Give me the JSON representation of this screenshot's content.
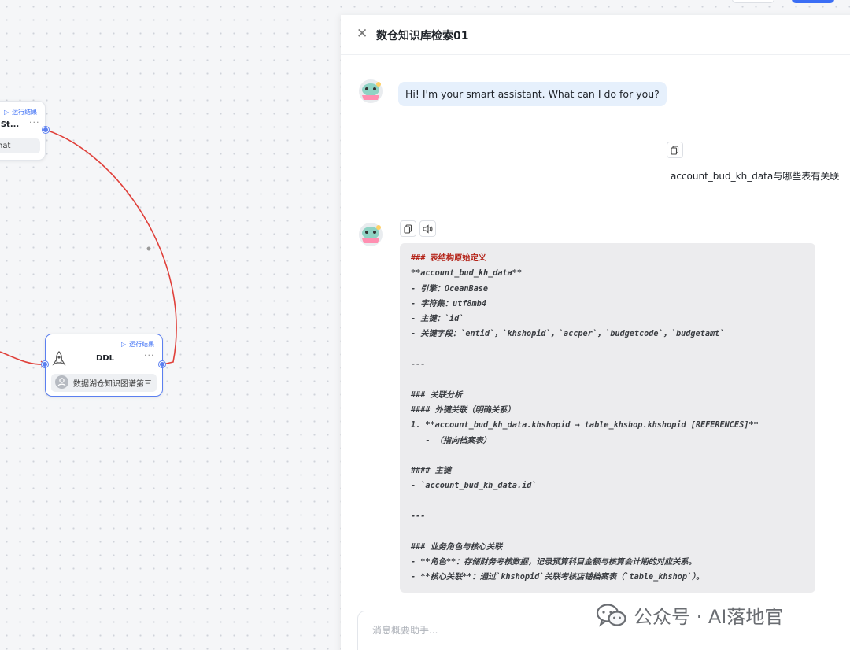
{
  "canvas": {
    "left_node": {
      "run_label": "运行结果",
      "title": "L St...",
      "chip": "hat",
      "more": "···"
    },
    "ddl_node": {
      "run_label": "运行结果",
      "title": "DDL",
      "chip": "数据湖仓知识图谱第三",
      "more": "···"
    },
    "edge_color": "#e0403a",
    "port_color": "#5b7ff0"
  },
  "panel": {
    "title": "数仓知识库检索01",
    "close_icon": "close-icon",
    "messages": {
      "greeting": "Hi! I'm your smart assistant. What can I do for you?",
      "user_query": "account_bud_kh_data与哪些表有关联",
      "answer_lines": [
        "### 表结构原始定义",
        "**account_bud_kh_data**",
        "- 引擎：OceanBase",
        "- 字符集：utf8mb4",
        "- 主键：`id`",
        "- 关键字段：`entid`，`khshopid`，`accper`，`budgetcode`，`budgetamt`",
        "",
        "---",
        "",
        "### 关联分析",
        "#### 外键关联（明确关系）",
        "1. **account_bud_kh_data.khshopid → table_khshop.khshopid [REFERENCES]**",
        "   - （指向档案表）",
        "",
        "#### 主键",
        "- `account_bud_kh_data.id`",
        "",
        "---",
        "",
        "### 业务角色与核心关联",
        "- **角色**：存储财务考核数据，记录预算科目金额与核算会计期的对应关系。",
        "- **核心关联**：通过`khshopid`关联考核店铺档案表（`table_khshop`）。"
      ]
    },
    "input": {
      "placeholder": "消息概要助手..."
    }
  },
  "watermark": {
    "text": "公众号 · AI落地官",
    "icon": "wechat-icon"
  }
}
